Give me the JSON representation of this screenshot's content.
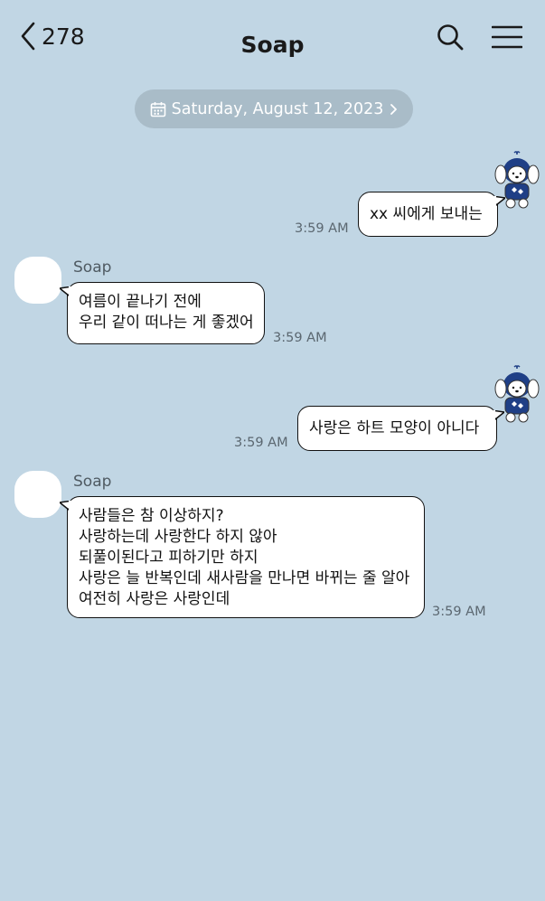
{
  "header": {
    "back_count": "278",
    "title": "Soap"
  },
  "date_divider": {
    "label": "Saturday, August 12, 2023"
  },
  "messages": [
    {
      "side": "right",
      "lines": [
        "xx 씨에게 보내는"
      ],
      "time": "3:59 AM"
    },
    {
      "side": "left",
      "sender": "Soap",
      "lines": [
        "여름이 끝나기 전에",
        "우리 같이 떠나는 게 좋겠어"
      ],
      "time": "3:59 AM"
    },
    {
      "side": "right",
      "lines": [
        "사랑은 하트 모양이 아니다"
      ],
      "time": "3:59 AM"
    },
    {
      "side": "left",
      "sender": "Soap",
      "lines": [
        "사람들은 참 이상하지?",
        "사랑하는데 사랑한다 하지 않아",
        "되풀이된다고 피하기만 하지",
        "사랑은 늘 반복인데 새사람을 만나면 바뀌는 줄 알아",
        "여전히 사랑은 사랑인데"
      ],
      "time": "3:59 AM"
    }
  ],
  "colors": {
    "background": "#c1d6e4",
    "date_pill": "#a9bcc8",
    "bubble": "#ffffff",
    "sticker_hood": "#1f3f86"
  },
  "icons": {
    "back": "chevron-left-icon",
    "search": "search-icon",
    "menu": "hamburger-menu-icon",
    "calendar": "calendar-icon",
    "date_chevron": "chevron-right-icon",
    "sticker": "puppy-sticker"
  }
}
